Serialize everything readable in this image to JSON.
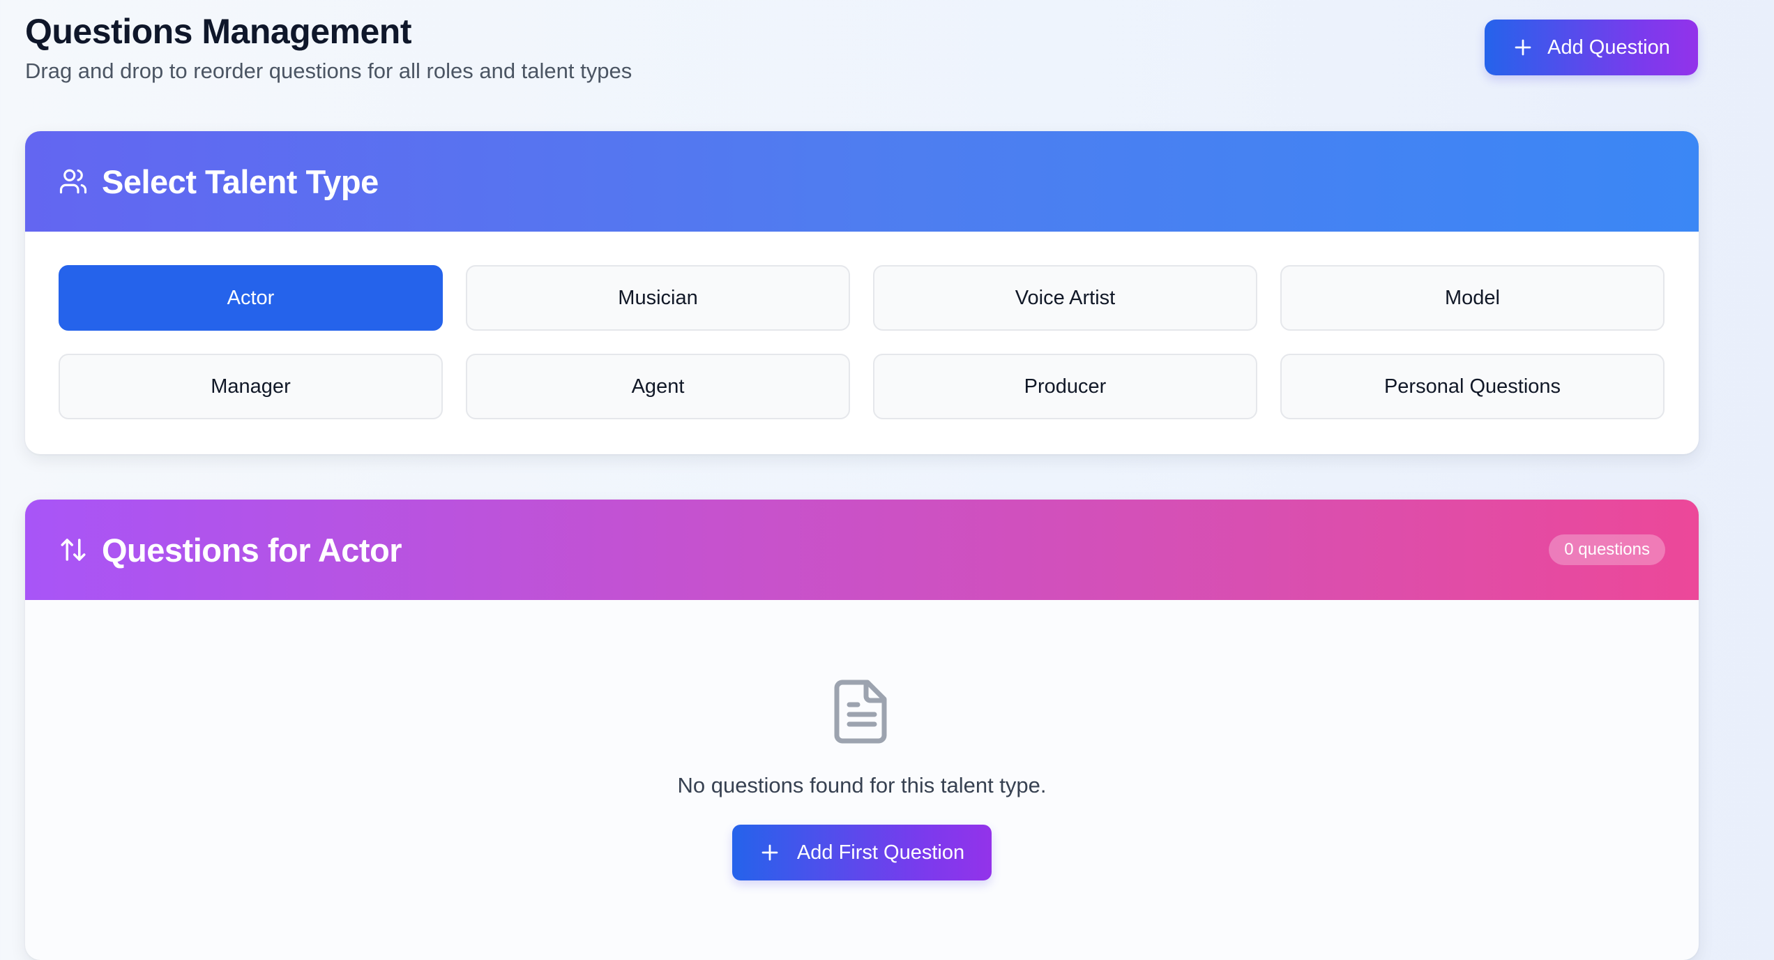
{
  "header": {
    "title": "Questions Management",
    "subtitle": "Drag and drop to reorder questions for all roles and talent types",
    "add_button_label": "Add Question"
  },
  "talent_section": {
    "title": "Select Talent Type",
    "icon": "users-icon",
    "types": [
      "Actor",
      "Musician",
      "Voice Artist",
      "Model",
      "Manager",
      "Agent",
      "Producer",
      "Personal Questions"
    ],
    "selected": "Actor"
  },
  "questions_section": {
    "title": "Questions for Actor",
    "icon": "sort-arrows-icon",
    "count_badge": "0 questions",
    "empty_icon": "document-icon",
    "empty_text": "No questions found for this talent type.",
    "add_first_label": "Add First Question"
  },
  "colors": {
    "primary": "#2563eb",
    "gradient_blue_start": "#6366f1",
    "gradient_blue_end": "#3b87f5",
    "gradient_pink_start": "#a855f7",
    "gradient_pink_end": "#ec4899",
    "button_gradient_end": "#9333ea"
  }
}
